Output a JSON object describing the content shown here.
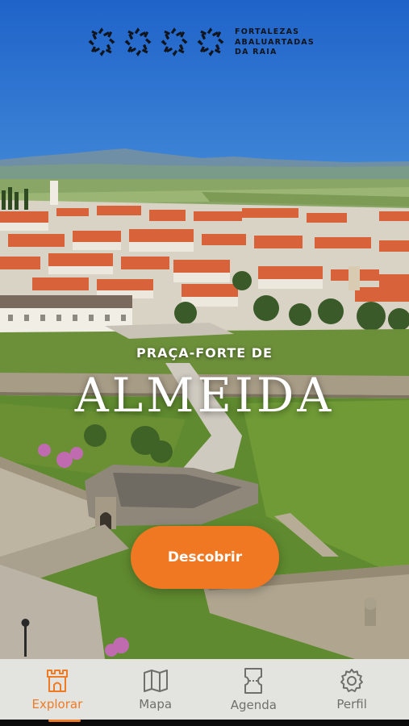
{
  "brand": {
    "line1": "FORTALEZAS",
    "line2": "ABALUARTADAS",
    "line3": "DA RAIA",
    "mark_icons": [
      "bastion-star-icon",
      "bastion-star-icon",
      "bastion-star-icon",
      "bastion-star-icon"
    ]
  },
  "hero": {
    "subtitle": "PRAÇA-FORTE DE",
    "title": "ALMEIDA"
  },
  "cta": {
    "label": "Descobrir"
  },
  "tabs": [
    {
      "label": "Explorar",
      "icon": "castle-tower-icon",
      "active": true
    },
    {
      "label": "Mapa",
      "icon": "map-icon",
      "active": false
    },
    {
      "label": "Agenda",
      "icon": "ticket-icon",
      "active": false
    },
    {
      "label": "Perfil",
      "icon": "gear-icon",
      "active": false
    }
  ],
  "colors": {
    "accent": "#f07822",
    "tabbar_bg": "#e3e3df",
    "tab_inactive": "#6f6f6c"
  }
}
